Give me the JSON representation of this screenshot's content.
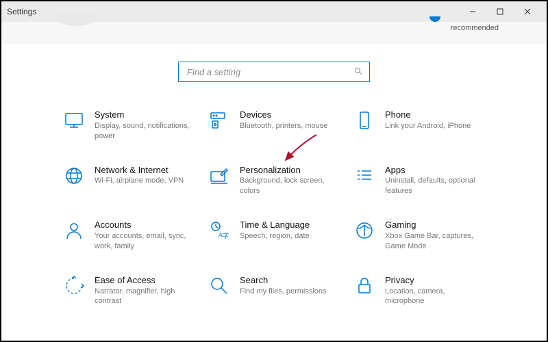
{
  "window": {
    "title": "Settings"
  },
  "account": {
    "status_text": "recommended"
  },
  "search": {
    "placeholder": "Find a setting"
  },
  "categories": [
    {
      "icon": "monitor-icon",
      "title": "System",
      "desc": "Display, sound, notifications, power"
    },
    {
      "icon": "devices-icon",
      "title": "Devices",
      "desc": "Bluetooth, printers, mouse"
    },
    {
      "icon": "phone-icon",
      "title": "Phone",
      "desc": "Link your Android, iPhone"
    },
    {
      "icon": "globe-icon",
      "title": "Network & Internet",
      "desc": "Wi-Fi, airplane mode, VPN"
    },
    {
      "icon": "brush-icon",
      "title": "Personalization",
      "desc": "Background, lock screen, colors"
    },
    {
      "icon": "apps-icon",
      "title": "Apps",
      "desc": "Uninstall, defaults, optional features"
    },
    {
      "icon": "person-icon",
      "title": "Accounts",
      "desc": "Your accounts, email, sync, work, family"
    },
    {
      "icon": "time-lang-icon",
      "title": "Time & Language",
      "desc": "Speech, region, date"
    },
    {
      "icon": "gaming-icon",
      "title": "Gaming",
      "desc": "Xbox Game Bar, captures, Game Mode"
    },
    {
      "icon": "ease-icon",
      "title": "Ease of Access",
      "desc": "Narrator, magnifier, high contrast"
    },
    {
      "icon": "search-icon",
      "title": "Search",
      "desc": "Find my files, permissions"
    },
    {
      "icon": "privacy-icon",
      "title": "Privacy",
      "desc": "Location, camera, microphone"
    }
  ],
  "annotation": {
    "arrow_target": "Personalization",
    "arrow_color": "#b01030"
  }
}
